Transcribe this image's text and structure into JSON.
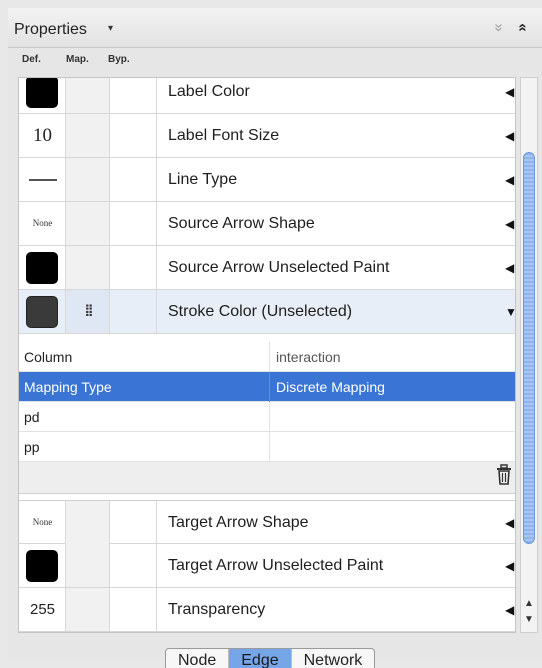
{
  "header": {
    "title": "Properties",
    "menu_caret": "▾",
    "collapse_all": "»",
    "expand_all": "«"
  },
  "columns": {
    "def": "Def.",
    "map": "Map.",
    "byp": "Byp."
  },
  "rows_top": [
    {
      "label": "Label Color",
      "default": ""
    },
    {
      "label": "Label Font Size",
      "default": "10"
    },
    {
      "label": "Line Type",
      "default": ""
    },
    {
      "label": "Source Arrow Shape",
      "default": "None"
    },
    {
      "label": "Source Arrow Unselected Paint",
      "default": ""
    },
    {
      "label": "Stroke Color (Unselected)",
      "default": ""
    }
  ],
  "mapping": {
    "rows": [
      {
        "key": "Column",
        "value": "interaction"
      },
      {
        "key": "Mapping Type",
        "value": "Discrete Mapping"
      },
      {
        "key": "pd",
        "value": ""
      },
      {
        "key": "pp",
        "value": ""
      }
    ]
  },
  "rows_bottom": [
    {
      "label": "Target Arrow Shape",
      "default": "None"
    },
    {
      "label": "Target Arrow Unselected Paint",
      "default": ""
    },
    {
      "label": "Transparency",
      "default": "255"
    }
  ],
  "tabs": {
    "node": "Node",
    "edge": "Edge",
    "network": "Network",
    "active": "Edge"
  },
  "colors": {
    "selection": "#3a75d6",
    "scroll_thumb": "#8fb4ea",
    "active_tab": "#76a5e8"
  }
}
